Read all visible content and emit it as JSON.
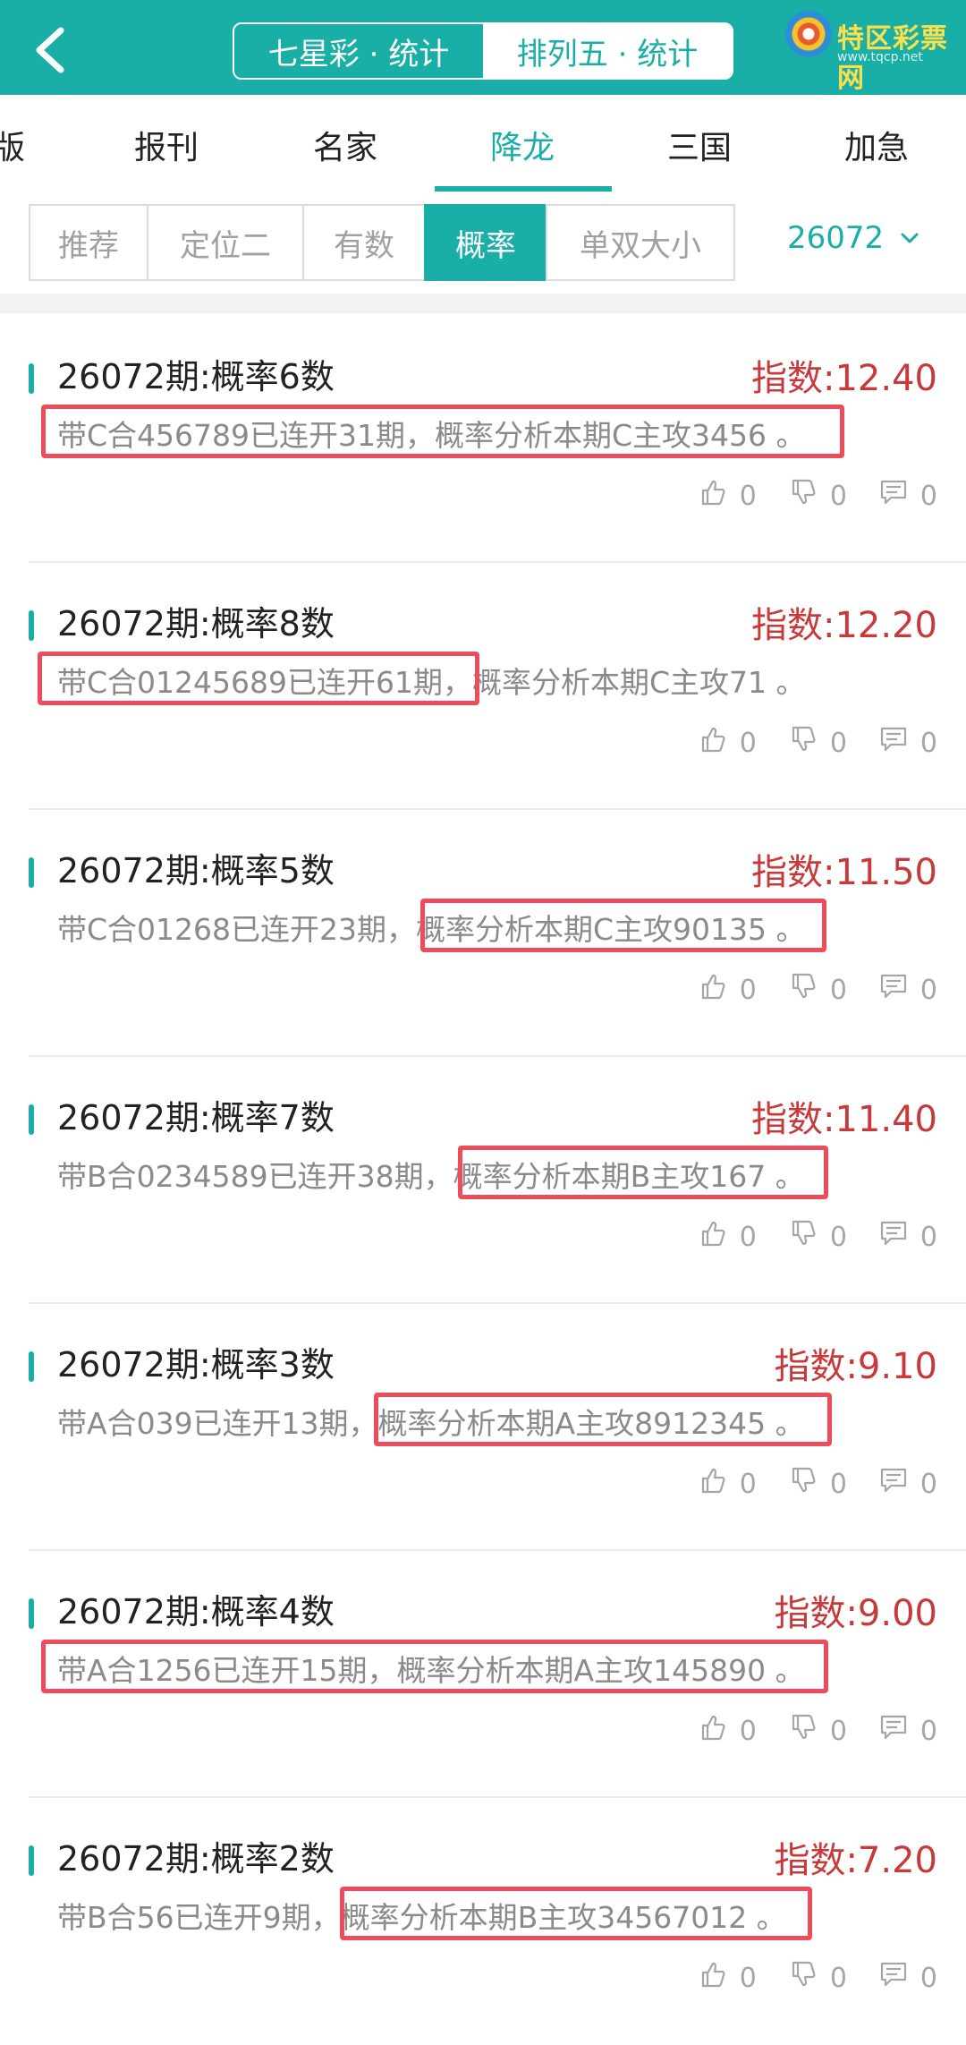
{
  "header": {
    "back_icon": "chevron-left-icon",
    "tabs": [
      "七星彩 · 统计",
      "排列五 · 统计"
    ],
    "logo_text": "特区彩票网",
    "logo_sub": "www.tqcp.net"
  },
  "nav": {
    "items": [
      "版",
      "报刊",
      "名家",
      "降龙",
      "三国",
      "加急"
    ],
    "active": "降龙"
  },
  "filters": {
    "chips": [
      "推荐",
      "定位二",
      "有数",
      "概率",
      "单双大小"
    ],
    "active": "概率",
    "issue_value": "26072"
  },
  "cards": [
    {
      "title": "26072期:概率6数",
      "index": "指数:12.40",
      "desc": "带C合456789已连开31期，概率分析本期C主攻3456 。",
      "likes": "0",
      "dislikes": "0",
      "comments": "0"
    },
    {
      "title": "26072期:概率8数",
      "index": "指数:12.20",
      "desc": "带C合01245689已连开61期，概率分析本期C主攻71 。",
      "likes": "0",
      "dislikes": "0",
      "comments": "0"
    },
    {
      "title": "26072期:概率5数",
      "index": "指数:11.50",
      "desc": "带C合01268已连开23期，概率分析本期C主攻90135 。",
      "likes": "0",
      "dislikes": "0",
      "comments": "0"
    },
    {
      "title": "26072期:概率7数",
      "index": "指数:11.40",
      "desc": "带B合0234589已连开38期，概率分析本期B主攻167 。",
      "likes": "0",
      "dislikes": "0",
      "comments": "0"
    },
    {
      "title": "26072期:概率3数",
      "index": "指数:9.10",
      "desc": "带A合039已连开13期，概率分析本期A主攻8912345 。",
      "likes": "0",
      "dislikes": "0",
      "comments": "0"
    },
    {
      "title": "26072期:概率4数",
      "index": "指数:9.00",
      "desc": "带A合1256已连开15期，概率分析本期A主攻145890 。",
      "likes": "0",
      "dislikes": "0",
      "comments": "0"
    },
    {
      "title": "26072期:概率2数",
      "index": "指数:7.20",
      "desc": "带B合56已连开9期，概率分析本期B主攻34567012 。",
      "likes": "0",
      "dislikes": "0",
      "comments": "0"
    }
  ],
  "colors": {
    "accent": "#19aea6",
    "index_red": "#c7393a",
    "highlight_box": "#ee4c5b"
  }
}
